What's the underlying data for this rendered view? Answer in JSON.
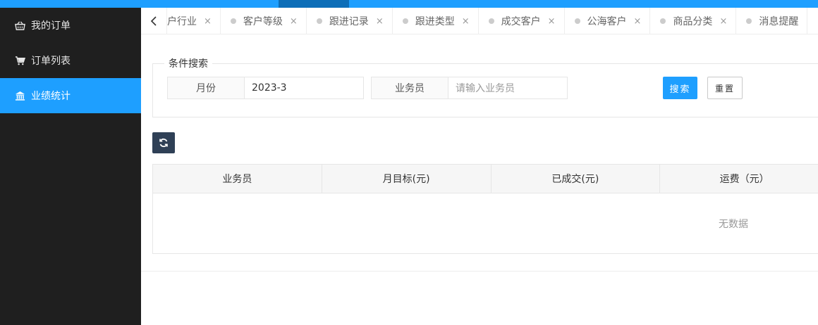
{
  "sidebar": {
    "items": [
      {
        "label": "我的订单",
        "icon": "basket-icon",
        "active": false
      },
      {
        "label": "订单列表",
        "icon": "cart-icon",
        "active": false
      },
      {
        "label": "业绩统计",
        "icon": "bank-icon",
        "active": true
      }
    ]
  },
  "tabs": {
    "items": [
      {
        "label": "户行业"
      },
      {
        "label": "客户等级"
      },
      {
        "label": "跟进记录"
      },
      {
        "label": "跟进类型"
      },
      {
        "label": "成交客户"
      },
      {
        "label": "公海客户"
      },
      {
        "label": "商品分类"
      },
      {
        "label": "消息提醒"
      }
    ],
    "close_glyph": "×"
  },
  "search": {
    "legend": "条件搜索",
    "month_label": "月份",
    "month_value": "2023-3",
    "salesman_label": "业务员",
    "salesman_placeholder": "请输入业务员",
    "search_button": "搜索",
    "reset_button": "重置"
  },
  "table": {
    "columns": [
      "业务员",
      "月目标(元)",
      "已成交(元)",
      "运费（元）"
    ],
    "empty_text": "无数据"
  },
  "colors": {
    "accent": "#1e9fff",
    "sidebar_bg": "#1f1f1f",
    "refresh_bg": "#2f4056"
  }
}
